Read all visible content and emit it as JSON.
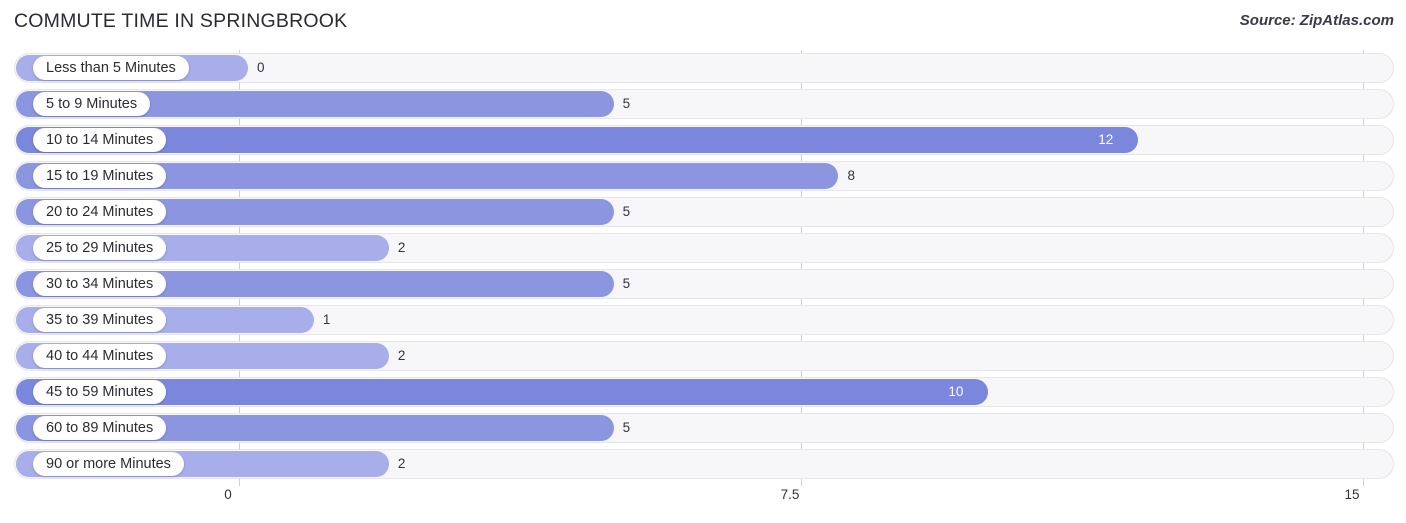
{
  "header": {
    "title": "COMMUTE TIME IN SPRINGBROOK",
    "source": "Source: ZipAtlas.com"
  },
  "chart_data": {
    "type": "bar",
    "orientation": "horizontal",
    "title": "COMMUTE TIME IN SPRINGBROOK",
    "source": "Source: ZipAtlas.com",
    "xlabel": "",
    "ylabel": "",
    "xlim": [
      0,
      15
    ],
    "ticks": [
      "0",
      "7.5",
      "15"
    ],
    "tick_values": [
      0,
      7.5,
      15
    ],
    "grid": true,
    "legend": false,
    "categories": [
      "Less than 5 Minutes",
      "5 to 9 Minutes",
      "10 to 14 Minutes",
      "15 to 19 Minutes",
      "20 to 24 Minutes",
      "25 to 29 Minutes",
      "30 to 34 Minutes",
      "35 to 39 Minutes",
      "40 to 44 Minutes",
      "45 to 59 Minutes",
      "60 to 89 Minutes",
      "90 or more Minutes"
    ],
    "values": [
      0,
      5,
      12,
      8,
      5,
      2,
      5,
      1,
      2,
      10,
      5,
      2
    ],
    "value_labels": [
      "0",
      "5",
      "12",
      "8",
      "5",
      "2",
      "5",
      "1",
      "2",
      "10",
      "5",
      "2"
    ],
    "bar_colors": [
      "#a7aeea",
      "#8b95e0",
      "#7b87dc",
      "#8b95e0",
      "#8b95e0",
      "#a7aeea",
      "#8b95e0",
      "#a7aeea",
      "#a7aeea",
      "#7b87dc",
      "#8b95e0",
      "#a7aeea"
    ],
    "track_color": "#f7f7f9",
    "accent_color": "#8b95e0"
  }
}
